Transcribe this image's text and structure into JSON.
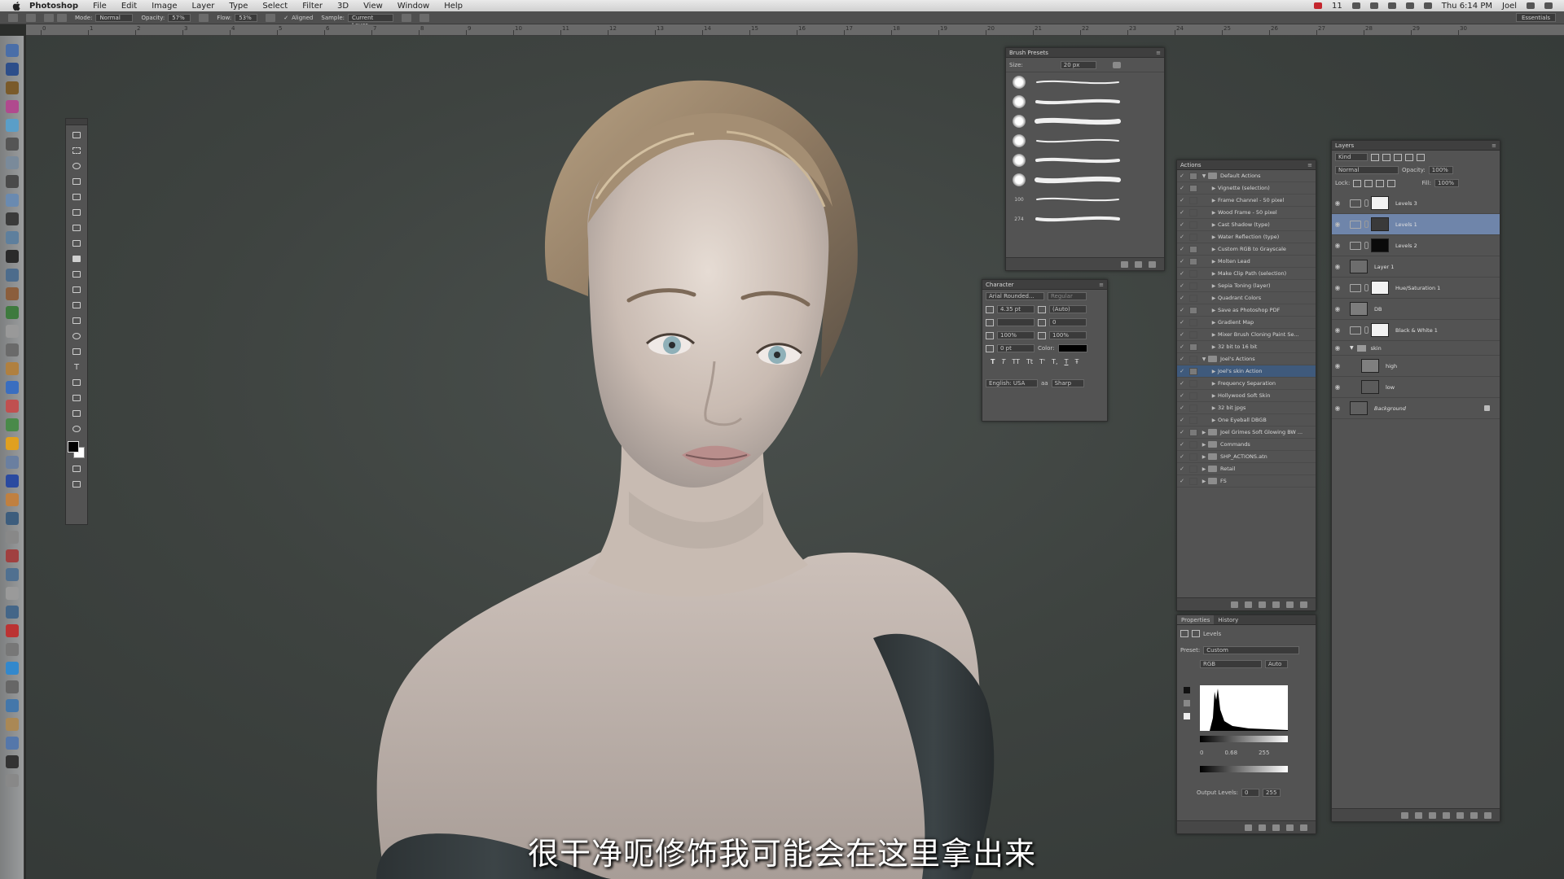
{
  "menubar": {
    "app": "Photoshop",
    "menus": [
      "File",
      "Edit",
      "Image",
      "Layer",
      "Type",
      "Select",
      "Filter",
      "3D",
      "View",
      "Window",
      "Help"
    ],
    "status_num": "11",
    "clock": "Thu 6:14 PM",
    "user": "Joel"
  },
  "options": {
    "mode_label": "Mode:",
    "mode_value": "Normal",
    "opacity_label": "Opacity:",
    "opacity_value": "57%",
    "flow_label": "Flow:",
    "flow_value": "53%",
    "aligned_label": "Aligned",
    "sample_label": "Sample:",
    "sample_value": "Current Layer",
    "workspace": "Essentials"
  },
  "ruler_ticks": [
    "0",
    "1",
    "2",
    "3",
    "4",
    "5",
    "6",
    "7",
    "8",
    "9",
    "10",
    "11",
    "12",
    "13",
    "14",
    "15",
    "16",
    "17",
    "18",
    "19",
    "20",
    "21",
    "22",
    "23",
    "24",
    "25",
    "26",
    "27",
    "28",
    "29",
    "30"
  ],
  "brush_presets": {
    "title": "Brush Presets",
    "size_label": "Size:",
    "size_value": "20 px",
    "row_labels": [
      "",
      "",
      "",
      "",
      "",
      "",
      "100",
      "274"
    ]
  },
  "character": {
    "title": "Character",
    "font_family": "Arial Rounded...",
    "font_style": "Regular",
    "font_size": "4.35 pt",
    "leading": "(Auto)",
    "kerning": "",
    "tracking": "0",
    "vscale": "100%",
    "hscale": "100%",
    "baseline": "0 pt",
    "color_label": "Color:",
    "styles": [
      "T",
      "T",
      "TT",
      "Tt",
      "T'",
      "T,",
      "T",
      "Ŧ"
    ],
    "language": "English: USA",
    "aa_label": "aa",
    "antialias": "Sharp"
  },
  "actions": {
    "title": "Actions",
    "rows": [
      {
        "name": "Default Actions",
        "type": "set",
        "open": true
      },
      {
        "name": "Vignette (selection)",
        "type": "action"
      },
      {
        "name": "Frame Channel - 50 pixel",
        "type": "action"
      },
      {
        "name": "Wood Frame - 50 pixel",
        "type": "action"
      },
      {
        "name": "Cast Shadow (type)",
        "type": "action"
      },
      {
        "name": "Water Reflection (type)",
        "type": "action"
      },
      {
        "name": "Custom RGB to Grayscale",
        "type": "action"
      },
      {
        "name": "Molten Lead",
        "type": "action"
      },
      {
        "name": "Make Clip Path (selection)",
        "type": "action"
      },
      {
        "name": "Sepia Toning (layer)",
        "type": "action"
      },
      {
        "name": "Quadrant Colors",
        "type": "action"
      },
      {
        "name": "Save as Photoshop PDF",
        "type": "action"
      },
      {
        "name": "Gradient Map",
        "type": "action"
      },
      {
        "name": "Mixer Brush Cloning Paint Se...",
        "type": "action"
      },
      {
        "name": "32 bit to 16 bit",
        "type": "action"
      },
      {
        "name": "Joel's Actions",
        "type": "set",
        "open": true
      },
      {
        "name": "Joel's skin Action",
        "type": "action",
        "selected": true
      },
      {
        "name": "Frequency Separation",
        "type": "action"
      },
      {
        "name": "Hollywood Soft Skin",
        "type": "action"
      },
      {
        "name": "32 bit jpgs",
        "type": "action"
      },
      {
        "name": "One Eyeball DBGB",
        "type": "action"
      },
      {
        "name": "Joel Grimes Soft Glowing BW ...",
        "type": "set"
      },
      {
        "name": "Commands",
        "type": "set"
      },
      {
        "name": "SHP_ACTIONS.atn",
        "type": "set"
      },
      {
        "name": "Retail",
        "type": "set"
      },
      {
        "name": "FS",
        "type": "set"
      }
    ]
  },
  "properties": {
    "tab_properties": "Properties",
    "tab_history": "History",
    "adj_name": "Levels",
    "preset_label": "Preset:",
    "preset_value": "Custom",
    "channel": "RGB",
    "auto_label": "Auto",
    "input_black": "0",
    "input_mid": "0.68",
    "input_white": "255",
    "output_label": "Output Levels:",
    "output_black": "0",
    "output_white": "255"
  },
  "layers": {
    "title": "Layers",
    "kind_label": "Kind",
    "blend_mode": "Normal",
    "opacity_label": "Opacity:",
    "opacity_value": "100%",
    "lock_label": "Lock:",
    "fill_label": "Fill:",
    "fill_value": "100%",
    "rows": [
      {
        "name": "Levels 3",
        "kind": "adj",
        "thumb": "#f2f2f2"
      },
      {
        "name": "Levels 1",
        "kind": "adj",
        "thumb": "#3a3a3a",
        "selected": true
      },
      {
        "name": "Levels 2",
        "kind": "adj",
        "thumb": "#0a0a0a"
      },
      {
        "name": "Layer 1",
        "kind": "pixel",
        "thumb": "#6d6d6d"
      },
      {
        "name": "Hue/Saturation 1",
        "kind": "adj",
        "thumb": "#f2f2f2"
      },
      {
        "name": "DB",
        "kind": "pixel",
        "thumb": "#7c7c7c"
      },
      {
        "name": "Black & White 1",
        "kind": "adj",
        "thumb": "#f2f2f2"
      },
      {
        "name": "skin",
        "kind": "group"
      },
      {
        "name": "high",
        "kind": "pixel",
        "thumb": "#7f7f7f",
        "indent": true
      },
      {
        "name": "low",
        "kind": "pixel",
        "thumb": "#5b5b5b",
        "indent": true
      },
      {
        "name": "Background",
        "kind": "pixel",
        "thumb": "#606060",
        "locked": true
      }
    ]
  },
  "subtitle": "很干净呃修饰我可能会在这里拿出来"
}
